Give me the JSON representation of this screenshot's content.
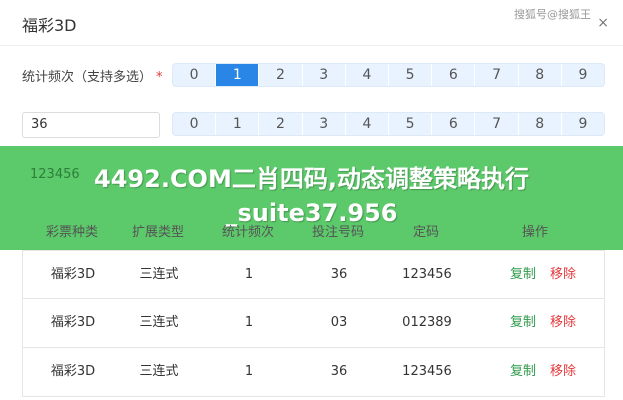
{
  "header": {
    "title": "福彩3D",
    "watermark": "搜狐号@搜狐王",
    "close_symbol": "×"
  },
  "form": {
    "label": "统计频次（支持多选）",
    "required_mark": "*",
    "freq_options": [
      "0",
      "1",
      "2",
      "3",
      "4",
      "5",
      "6",
      "7",
      "8",
      "9"
    ],
    "freq_selected": "1",
    "number_value": "36",
    "digit_options": [
      "0",
      "1",
      "2",
      "3",
      "4",
      "5",
      "6",
      "7",
      "8",
      "9"
    ]
  },
  "overlay": {
    "stub_text": "123456",
    "line1": "4492.COM二肖四码,动态调整策略执行",
    "line2": "_suite37.956"
  },
  "table": {
    "headers": [
      "彩票种类",
      "扩展类型",
      "统计频次",
      "投注号码",
      "定码",
      "操作"
    ],
    "rows": [
      {
        "type": "福彩3D",
        "ext": "三连式",
        "freq": "1",
        "num": "36",
        "code": "123456"
      },
      {
        "type": "福彩3D",
        "ext": "三连式",
        "freq": "1",
        "num": "03",
        "code": "012389"
      },
      {
        "type": "福彩3D",
        "ext": "三连式",
        "freq": "1",
        "num": "36",
        "code": "123456"
      }
    ],
    "copy_label": "复制",
    "remove_label": "移除"
  },
  "colors": {
    "accent": "#2a86e6",
    "green_banner": "#5cc96a",
    "copy": "#2e9a4a",
    "remove": "#e4393c"
  }
}
